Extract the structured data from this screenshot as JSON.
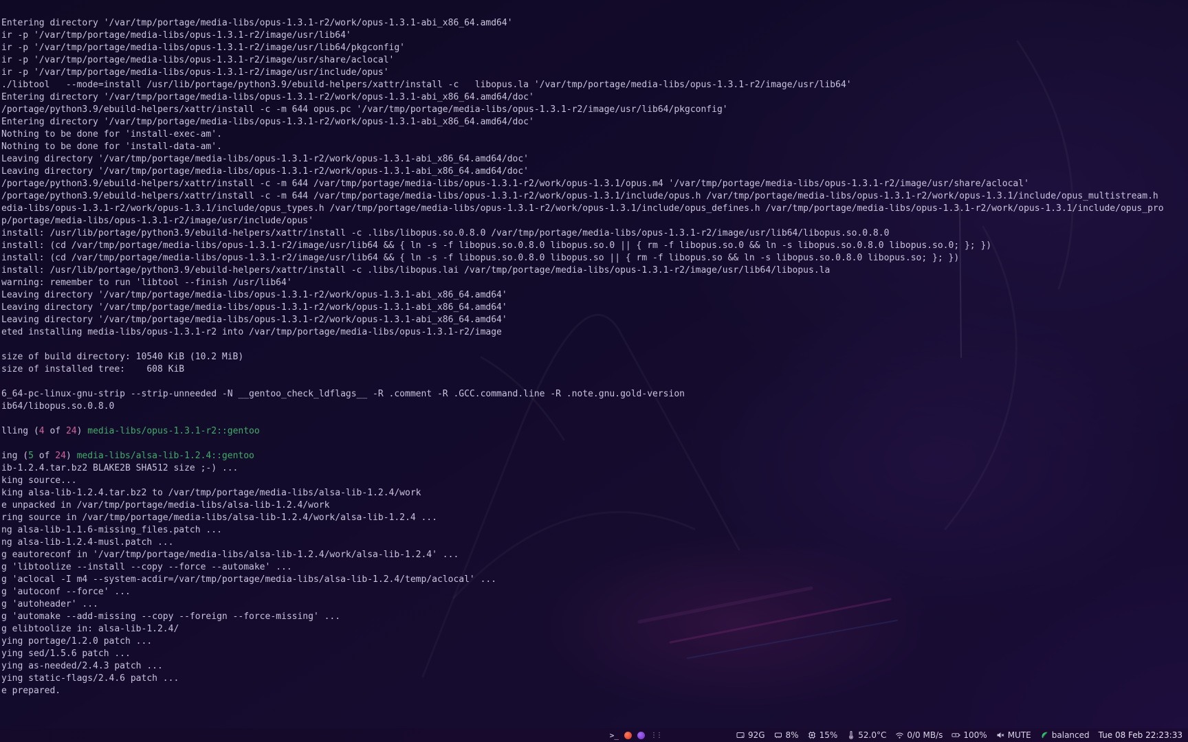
{
  "terminal": {
    "colors": {
      "fg": "#c9c3dd",
      "green": "#41ad69",
      "pink": "#cf639b"
    },
    "lines": [
      "Entering directory '/var/tmp/portage/media-libs/opus-1.3.1-r2/work/opus-1.3.1-abi_x86_64.amd64'",
      "ir -p '/var/tmp/portage/media-libs/opus-1.3.1-r2/image/usr/lib64'",
      "ir -p '/var/tmp/portage/media-libs/opus-1.3.1-r2/image/usr/lib64/pkgconfig'",
      "ir -p '/var/tmp/portage/media-libs/opus-1.3.1-r2/image/usr/share/aclocal'",
      "ir -p '/var/tmp/portage/media-libs/opus-1.3.1-r2/image/usr/include/opus'",
      "./libtool   --mode=install /usr/lib/portage/python3.9/ebuild-helpers/xattr/install -c   libopus.la '/var/tmp/portage/media-libs/opus-1.3.1-r2/image/usr/lib64'",
      "Entering directory '/var/tmp/portage/media-libs/opus-1.3.1-r2/work/opus-1.3.1-abi_x86_64.amd64/doc'",
      "/portage/python3.9/ebuild-helpers/xattr/install -c -m 644 opus.pc '/var/tmp/portage/media-libs/opus-1.3.1-r2/image/usr/lib64/pkgconfig'",
      "Entering directory '/var/tmp/portage/media-libs/opus-1.3.1-r2/work/opus-1.3.1-abi_x86_64.amd64/doc'",
      "Nothing to be done for 'install-exec-am'.",
      "Nothing to be done for 'install-data-am'.",
      "Leaving directory '/var/tmp/portage/media-libs/opus-1.3.1-r2/work/opus-1.3.1-abi_x86_64.amd64/doc'",
      "Leaving directory '/var/tmp/portage/media-libs/opus-1.3.1-r2/work/opus-1.3.1-abi_x86_64.amd64/doc'",
      "/portage/python3.9/ebuild-helpers/xattr/install -c -m 644 /var/tmp/portage/media-libs/opus-1.3.1-r2/work/opus-1.3.1/opus.m4 '/var/tmp/portage/media-libs/opus-1.3.1-r2/image/usr/share/aclocal'",
      "/portage/python3.9/ebuild-helpers/xattr/install -c -m 644 /var/tmp/portage/media-libs/opus-1.3.1-r2/work/opus-1.3.1/include/opus.h /var/tmp/portage/media-libs/opus-1.3.1-r2/work/opus-1.3.1/include/opus_multistream.h",
      "edia-libs/opus-1.3.1-r2/work/opus-1.3.1/include/opus_types.h /var/tmp/portage/media-libs/opus-1.3.1-r2/work/opus-1.3.1/include/opus_defines.h /var/tmp/portage/media-libs/opus-1.3.1-r2/work/opus-1.3.1/include/opus_pro",
      "p/portage/media-libs/opus-1.3.1-r2/image/usr/include/opus'",
      "install: /usr/lib/portage/python3.9/ebuild-helpers/xattr/install -c .libs/libopus.so.0.8.0 /var/tmp/portage/media-libs/opus-1.3.1-r2/image/usr/lib64/libopus.so.0.8.0",
      "install: (cd /var/tmp/portage/media-libs/opus-1.3.1-r2/image/usr/lib64 && { ln -s -f libopus.so.0.8.0 libopus.so.0 || { rm -f libopus.so.0 && ln -s libopus.so.0.8.0 libopus.so.0; }; })",
      "install: (cd /var/tmp/portage/media-libs/opus-1.3.1-r2/image/usr/lib64 && { ln -s -f libopus.so.0.8.0 libopus.so || { rm -f libopus.so && ln -s libopus.so.0.8.0 libopus.so; }; })",
      "install: /usr/lib/portage/python3.9/ebuild-helpers/xattr/install -c .libs/libopus.lai /var/tmp/portage/media-libs/opus-1.3.1-r2/image/usr/lib64/libopus.la",
      "warning: remember to run 'libtool --finish /usr/lib64'",
      "Leaving directory '/var/tmp/portage/media-libs/opus-1.3.1-r2/work/opus-1.3.1-abi_x86_64.amd64'",
      "Leaving directory '/var/tmp/portage/media-libs/opus-1.3.1-r2/work/opus-1.3.1-abi_x86_64.amd64'",
      "Leaving directory '/var/tmp/portage/media-libs/opus-1.3.1-r2/work/opus-1.3.1-abi_x86_64.amd64'",
      "eted installing media-libs/opus-1.3.1-r2 into /var/tmp/portage/media-libs/opus-1.3.1-r2/image",
      "",
      "size of build directory: 10540 KiB (10.2 MiB)",
      "size of installed tree:    608 KiB",
      "",
      "6_64-pc-linux-gnu-strip --strip-unneeded -N __gentoo_check_ldflags__ -R .comment -R .GCC.command.line -R .note.gnu.gold-version",
      "ib64/libopus.so.0.8.0",
      "",
      [
        {
          "t": "lling (",
          "c": "fg"
        },
        {
          "t": "4",
          "c": "pink"
        },
        {
          "t": " of ",
          "c": "fg"
        },
        {
          "t": "24",
          "c": "pink"
        },
        {
          "t": ") ",
          "c": "fg"
        },
        {
          "t": "media-libs/opus-1.3.1-r2::gentoo",
          "c": "green"
        }
      ],
      "",
      [
        {
          "t": "ing (",
          "c": "fg"
        },
        {
          "t": "5",
          "c": "green"
        },
        {
          "t": " of ",
          "c": "fg"
        },
        {
          "t": "24",
          "c": "pink"
        },
        {
          "t": ") ",
          "c": "fg"
        },
        {
          "t": "media-libs/alsa-lib-1.2.4::gentoo",
          "c": "green"
        }
      ],
      "ib-1.2.4.tar.bz2 BLAKE2B SHA512 size ;-) ...",
      "king source...",
      "king alsa-lib-1.2.4.tar.bz2 to /var/tmp/portage/media-libs/alsa-lib-1.2.4/work",
      "e unpacked in /var/tmp/portage/media-libs/alsa-lib-1.2.4/work",
      "ring source in /var/tmp/portage/media-libs/alsa-lib-1.2.4/work/alsa-lib-1.2.4 ...",
      "ng alsa-lib-1.1.6-missing_files.patch ...",
      "ng alsa-lib-1.2.4-musl.patch ...",
      "g eautoreconf in '/var/tmp/portage/media-libs/alsa-lib-1.2.4/work/alsa-lib-1.2.4' ...",
      "g 'libtoolize --install --copy --force --automake' ...",
      "g 'aclocal -I m4 --system-acdir=/var/tmp/portage/media-libs/alsa-lib-1.2.4/temp/aclocal' ...",
      "g 'autoconf --force' ...",
      "g 'autoheader' ...",
      "g 'automake --add-missing --copy --foreign --force-missing' ...",
      "g elibtoolize in: alsa-lib-1.2.4/",
      "ying portage/1.2.0 patch ...",
      "ying sed/1.5.6 patch ...",
      "ying as-needed/2.4.3 patch ...",
      "ying static-flags/2.4.6 patch ...",
      "e prepared."
    ]
  },
  "taskbar": {
    "tray": {
      "terminal_glyph": ">_",
      "dots": "⋮⋮"
    },
    "metrics": {
      "disk": "92G",
      "memory": "8%",
      "cpu": "15%",
      "temperature": "52.0°C",
      "network": "0/0 MB/s",
      "battery": "100%",
      "audio": "MUTE",
      "power_profile": "balanced"
    },
    "clock": "Tue 08 Feb 22:23:33",
    "accent_green": "#35c06a"
  }
}
